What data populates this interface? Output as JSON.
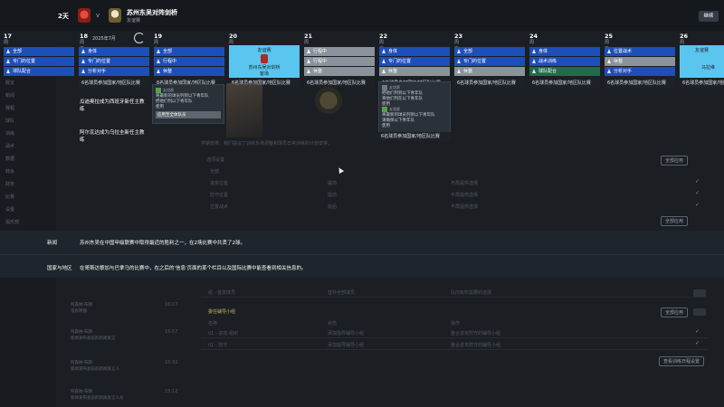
{
  "topbar": {
    "days_label": "2天",
    "vs": "v",
    "match_title": "苏州东吴对阵剑桥",
    "match_sub": "友谊赛",
    "next_button": "继续"
  },
  "calendar": {
    "month_label": "2025年7月",
    "days": [
      {
        "num": "17",
        "weekday": "周一"
      },
      {
        "num": "18",
        "weekday": "周五"
      },
      {
        "num": "19",
        "weekday": "周六"
      },
      {
        "num": "20",
        "weekday": "周日"
      },
      {
        "num": "21",
        "weekday": "周一"
      },
      {
        "num": "22",
        "weekday": "周二"
      },
      {
        "num": "23",
        "weekday": "周三"
      },
      {
        "num": "24",
        "weekday": "周一"
      },
      {
        "num": "25",
        "weekday": "周二"
      },
      {
        "num": "26",
        "weekday": "周三"
      }
    ],
    "col17": [
      "全部",
      "专门的位置",
      "球队配合"
    ],
    "col18": [
      "身体",
      "专门的位置",
      "分析对手"
    ],
    "col19": [
      "全部",
      "行程中",
      "休整"
    ],
    "col20_event": {
      "head": "友谊赛",
      "title": "苏州东吴对剑桥",
      "sub": "客场"
    },
    "col21": [
      "行程中",
      "行程中",
      "休整"
    ],
    "col22": [
      "身体",
      "专门的位置",
      "休整"
    ],
    "col23": [
      "全部",
      "专门的位置",
      "休整"
    ],
    "col24": [
      "身体",
      "战术训练",
      "球队配合"
    ],
    "col25": [
      "位置战术",
      "休整",
      "分析对手"
    ],
    "col26_event": {
      "head": "友谊赛",
      "title": "马拉维"
    },
    "stripe_text": "6名球员参加国家/地区队比赛"
  },
  "tooltips": {
    "left": {
      "head": "友谊赛",
      "line1": "将最新的球员列到以下青年队",
      "line2": "把他们列以下青年队",
      "line3": "使用",
      "highlight": "应用至全体队员"
    },
    "right": {
      "head1": "友谊赛",
      "line1": "把他们列到以下青年队",
      "line2": "将他们列在以下青年队",
      "line3": "使用",
      "head2": "友谊赛",
      "line4": "将最新的球员列到以下青年队",
      "line5": "请确保以下青年队",
      "line6": "使用",
      "stripe": "6名球员参加国家/地区队比赛"
    }
  },
  "left_messages": [
    "瓜迪奥拉成为西班牙新任主教练",
    "阿尔瓦达成为乌拉圭新任主教练"
  ],
  "nav": [
    "概览",
    "新闻",
    "赛程",
    "球队",
    "训练",
    "战术",
    "数据",
    "转会",
    "财务",
    "比赛",
    "设置",
    "俱乐部"
  ],
  "banner": {
    "label1": "新闻",
    "text1": "苏州东吴在中国甲级联赛中取得最近的胜利之一，在2场比赛中共丢了2球。",
    "label2": "国家与地区",
    "text2": "在哥斯达黎加与巴拿马的比赛中，在之后的'信息'页面的某个栏目以及国际比赛中能查看到相关信息的。"
  },
  "middle": {
    "hint": "学期安排，我们提议了训练负荷调整和球员日常训练的计划安排。",
    "section_label": "选项设置",
    "rows": [
      "全部",
      "进攻位置",
      "防守位置",
      "位置战术"
    ],
    "col_a": [
      "提前",
      "提前",
      "延后"
    ],
    "col_b": [
      "不再提供选择",
      "不再提供选择",
      "不再提供选择"
    ]
  },
  "lower": {
    "row1_a": "组 - 首发球员",
    "row1_b": "替补全部球员",
    "row1_c": "队内有所需要的选择",
    "section2": "委任辅导小组",
    "cols": [
      "名称",
      "状态",
      "操作"
    ],
    "row2_a": "01 - 进攻-组织",
    "row2_b": "添加指导辅导小组",
    "row2_c": "整合进攻防守的辅导小组",
    "row3_a": "01 - 防守",
    "row3_b": "添加指导辅导小组",
    "row3_c": "整合进攻防守的辅导小组",
    "button_a": "全部应用",
    "button_b": "全部应用",
    "button_c": "查看训练日程设置"
  },
  "feed": [
    {
      "from": "阿森纳·布朗",
      "text": "电视转播",
      "time": "16:07"
    },
    {
      "from": "阿森纳·布朗",
      "text": "新闻发布会前的新闻发言",
      "time": "15:57"
    },
    {
      "from": "阿森纳·布朗",
      "text": "新闻发布会前的新闻发言人",
      "time": "15:32"
    },
    {
      "from": "阿森纳·布朗",
      "text": "新闻发布会前的新闻发言人员",
      "time": "15:12"
    }
  ]
}
